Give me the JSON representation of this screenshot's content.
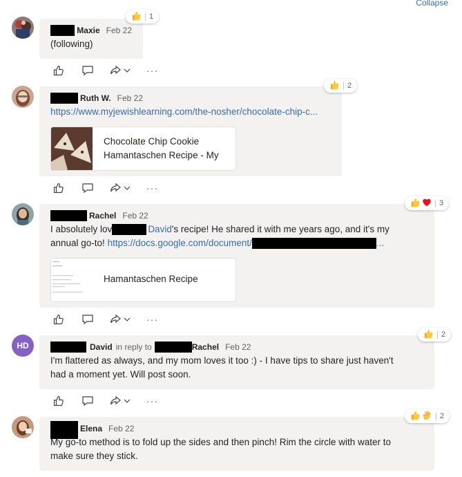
{
  "header": {
    "collapse_label": "Collapse"
  },
  "posts": [
    {
      "author": "Maxie",
      "date": "Feb 22",
      "text": "(following)",
      "reaction_count": "1"
    },
    {
      "author": "Ruth W.",
      "date": "Feb 22",
      "link": "https://www.myjewishlearning.com/the-nosher/chocolate-chip-c...",
      "preview_title_line1": "Chocolate Chip Cookie",
      "preview_title_line2": "Hamantaschen Recipe - My",
      "reaction_count": "2"
    },
    {
      "author": "Rachel",
      "date": "Feb 22",
      "text_part1": "I absolutely lov",
      "mention": "David",
      "text_part2": "'s recipe! He shared it with me years ago, and it's my",
      "text_line2_prefix": "annual go-to! ",
      "link": "https://docs.google.com/document/",
      "link_suffix": "...",
      "preview_title": "Hamantaschen Recipe",
      "reaction_count": "3"
    },
    {
      "avatar_initials": "HD",
      "author": "David",
      "reply_to_label": "in reply to",
      "reply_to_name": "Rachel",
      "date": "Feb 22",
      "text_line1": "I'm flattered as always, and my mom loves it too :)  - I have tips to share just haven't",
      "text_line2": "had a moment yet. Will post soon.",
      "reaction_count": "2"
    },
    {
      "author": "Elena",
      "date": "Feb 22",
      "text_line1": "My go-to method is to fold up the sides and then pinch! Rim the circle with water to",
      "text_line2": "make sure they stick.",
      "reaction_count": "2"
    }
  ],
  "icons": {
    "like": "thumbs-up-icon",
    "reply": "reply-icon",
    "share": "share-icon",
    "more": "more-options-icon",
    "heart": "heart-icon",
    "clap": "clapping-hands-icon",
    "accent_color": "#2f6fb6",
    "avatar_initials_bg": "#8661c5"
  }
}
